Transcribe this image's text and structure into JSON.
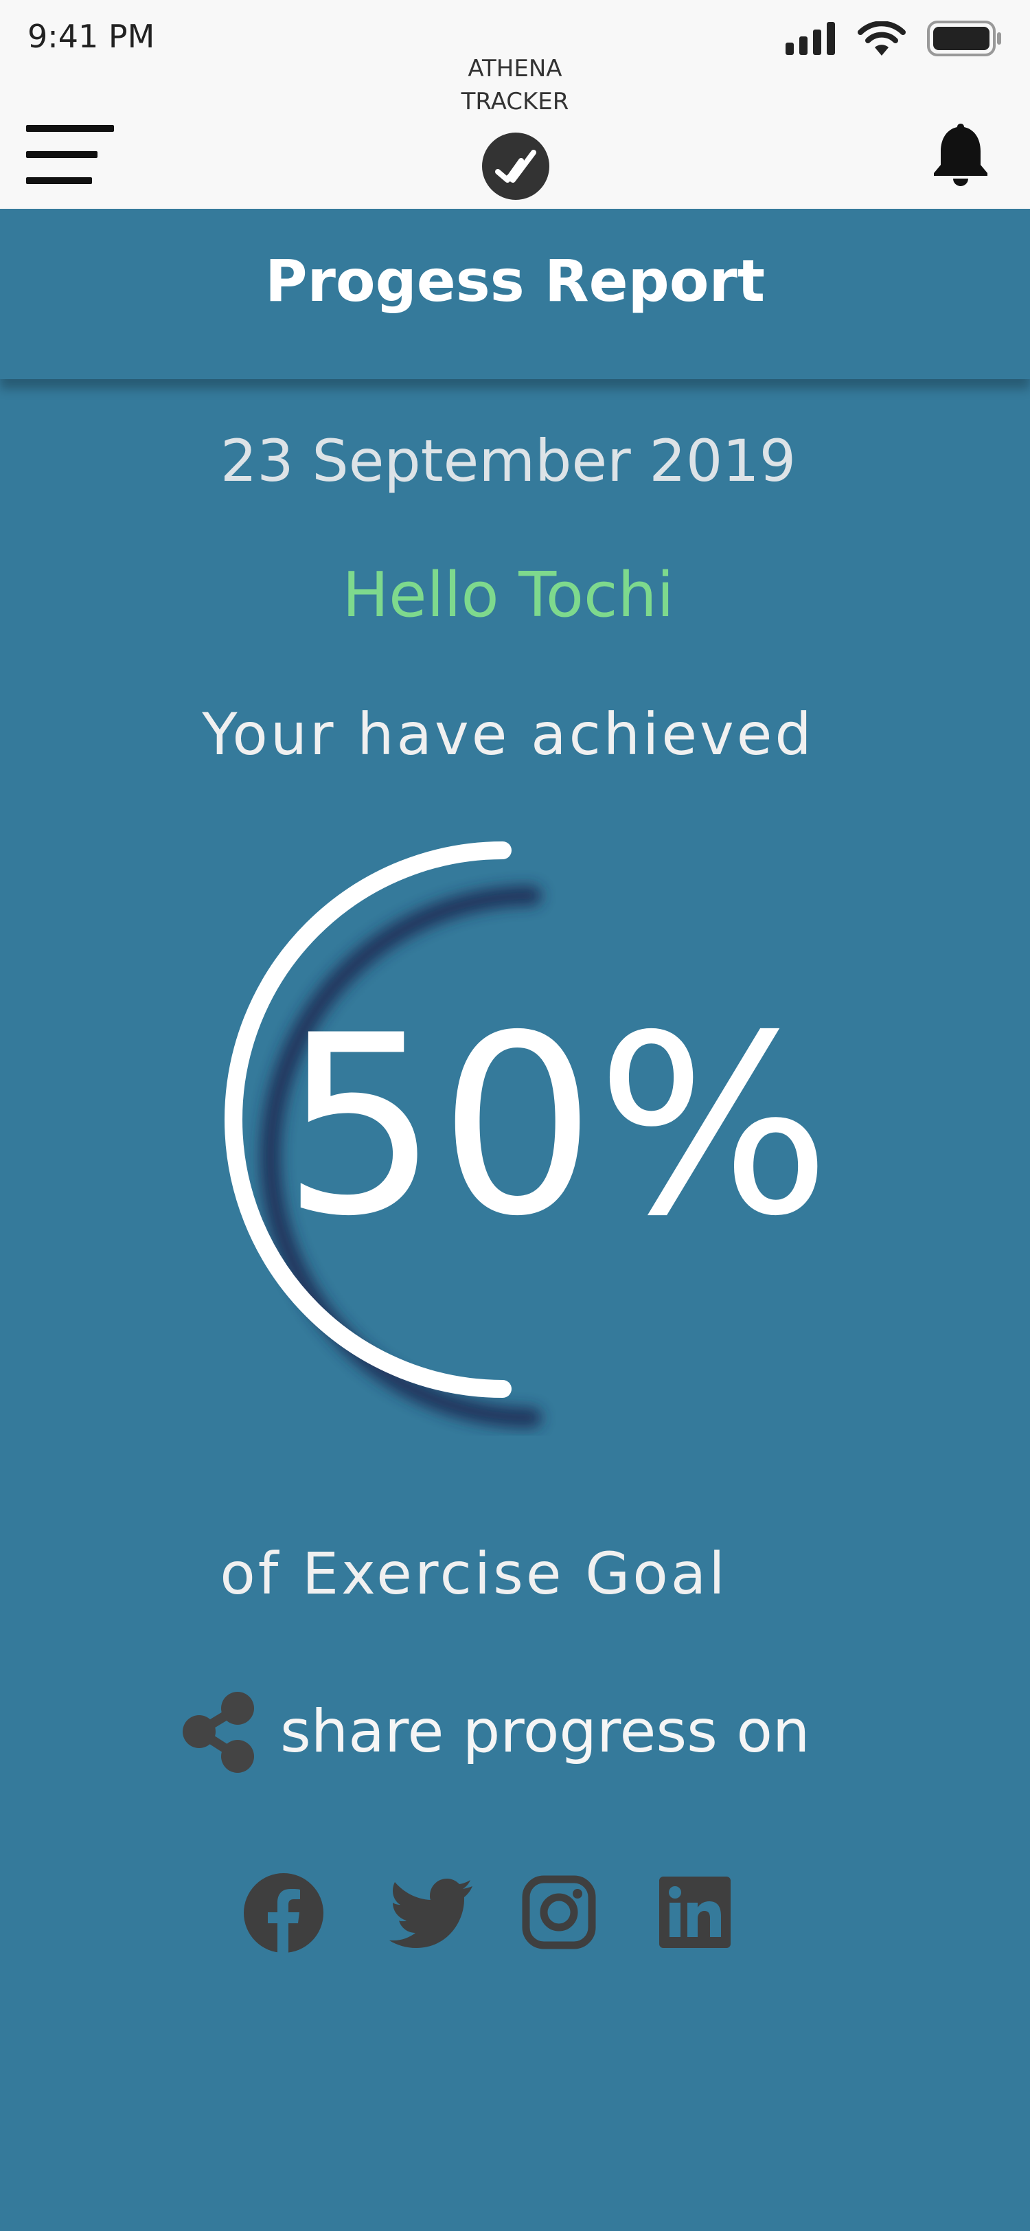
{
  "status_bar": {
    "time": "9:41 PM"
  },
  "header": {
    "brand_line1": "ATHENA",
    "brand_line2": "TRACKER"
  },
  "banner": {
    "title": "Progess Report"
  },
  "report": {
    "date": "23 September 2019",
    "greeting": "Hello Tochi",
    "achieved_text": "Your have achieved",
    "percent": "50%",
    "goal_text": "of Exercise Goal",
    "progress_fraction": 0.5
  },
  "share": {
    "label": "share progress on",
    "platforms": [
      "facebook",
      "twitter",
      "instagram",
      "linkedin"
    ]
  },
  "colors": {
    "background": "#357a9b",
    "header": "#f8f8f8",
    "greeting": "#7ed98d",
    "icons": "#3f3f3f"
  }
}
